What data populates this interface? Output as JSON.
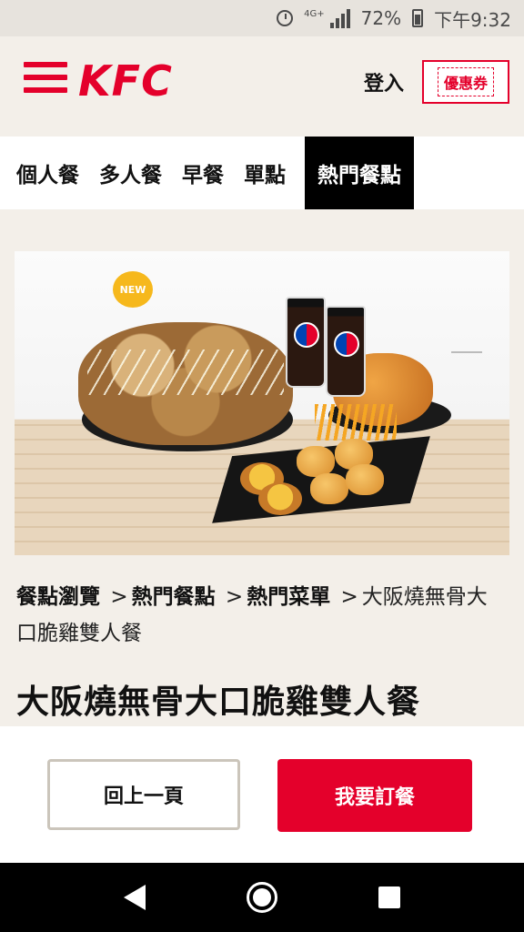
{
  "status_bar": {
    "network": "4G+",
    "battery": "72%",
    "time": "下午9:32"
  },
  "header": {
    "logo": "KFC",
    "login": "登入",
    "coupon": "優惠券"
  },
  "tabs": [
    {
      "label": "個人餐",
      "active": false
    },
    {
      "label": "多人餐",
      "active": false
    },
    {
      "label": "早餐",
      "active": false
    },
    {
      "label": "單點",
      "active": false
    },
    {
      "label": "熱門餐點",
      "active": true
    }
  ],
  "hero": {
    "badge": "NEW",
    "cup_brand": "Pepsi"
  },
  "breadcrumb": {
    "items": [
      "餐點瀏覽",
      "熱門餐點",
      "熱門菜單"
    ],
    "current": "大阪燒無骨大口脆雞雙人餐",
    "separator": ">"
  },
  "product": {
    "title": "大阪燒無骨大口脆雞雙人餐"
  },
  "actions": {
    "back": "回上一頁",
    "order": "我要訂餐"
  },
  "colors": {
    "brand": "#e4002b",
    "background": "#f3efe9"
  }
}
